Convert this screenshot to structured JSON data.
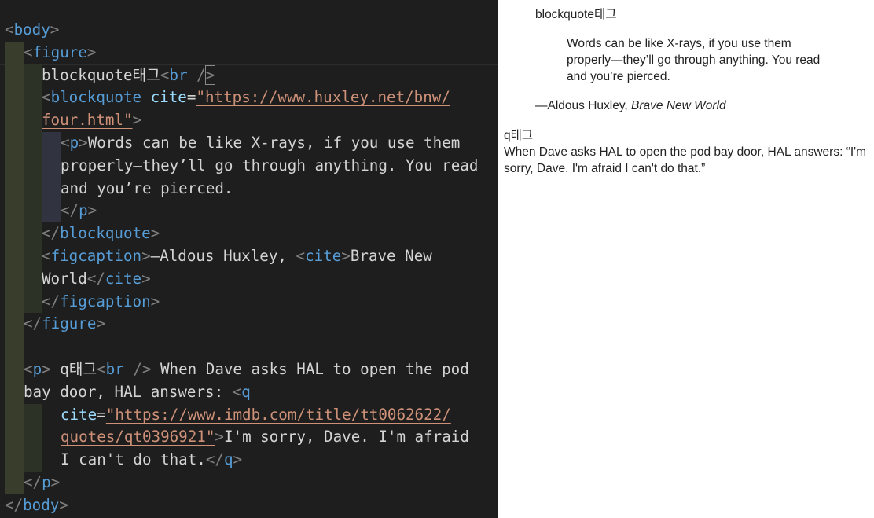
{
  "editor": {
    "lines": [
      [
        {
          "c": "tb",
          "t": "<"
        },
        {
          "c": "tg",
          "t": "body"
        },
        {
          "c": "tb",
          "t": ">"
        }
      ],
      [
        {
          "c": "tb",
          "t": "<"
        },
        {
          "c": "tg",
          "t": "figure"
        },
        {
          "c": "tb",
          "t": ">"
        }
      ],
      [
        {
          "c": "tx",
          "t": "blockquote태그"
        },
        {
          "c": "tb",
          "t": "<"
        },
        {
          "c": "tg",
          "t": "br"
        },
        {
          "c": "tx",
          "t": " "
        },
        {
          "c": "tb",
          "t": "/"
        },
        {
          "c": "tb cursor-box",
          "t": ">"
        }
      ],
      [
        {
          "c": "tb",
          "t": "<"
        },
        {
          "c": "tg",
          "t": "blockquote"
        },
        {
          "c": "tx",
          "t": " "
        },
        {
          "c": "at",
          "t": "cite"
        },
        {
          "c": "tx",
          "t": "="
        },
        {
          "c": "av",
          "t": "\"https://www.huxley.net/bnw/"
        }
      ],
      [
        {
          "c": "av",
          "t": "four.html"
        },
        {
          "c": "av",
          "t": "\""
        },
        {
          "c": "tb",
          "t": ">"
        }
      ],
      [
        {
          "c": "tb",
          "t": "<"
        },
        {
          "c": "tg",
          "t": "p"
        },
        {
          "c": "tb",
          "t": ">"
        },
        {
          "c": "tx",
          "t": "Words can be like X-rays, if you use them"
        }
      ],
      [
        {
          "c": "tx",
          "t": "properly—they’ll go through anything. You read"
        }
      ],
      [
        {
          "c": "tx",
          "t": "and you’re pierced."
        }
      ],
      [
        {
          "c": "tb",
          "t": "</"
        },
        {
          "c": "tg",
          "t": "p"
        },
        {
          "c": "tb",
          "t": ">"
        }
      ],
      [
        {
          "c": "tb",
          "t": "</"
        },
        {
          "c": "tg",
          "t": "blockquote"
        },
        {
          "c": "tb",
          "t": ">"
        }
      ],
      [
        {
          "c": "tb",
          "t": "<"
        },
        {
          "c": "tg",
          "t": "figcaption"
        },
        {
          "c": "tb",
          "t": ">"
        },
        {
          "c": "tx",
          "t": "—Aldous Huxley, "
        },
        {
          "c": "tb",
          "t": "<"
        },
        {
          "c": "tg",
          "t": "cite"
        },
        {
          "c": "tb",
          "t": ">"
        },
        {
          "c": "tx",
          "t": "Brave New"
        }
      ],
      [
        {
          "c": "tx",
          "t": "World"
        },
        {
          "c": "tb",
          "t": "</"
        },
        {
          "c": "tg",
          "t": "cite"
        },
        {
          "c": "tb",
          "t": ">"
        }
      ],
      [
        {
          "c": "tb",
          "t": "</"
        },
        {
          "c": "tg",
          "t": "figcaption"
        },
        {
          "c": "tb",
          "t": ">"
        }
      ],
      [
        {
          "c": "tb",
          "t": "</"
        },
        {
          "c": "tg",
          "t": "figure"
        },
        {
          "c": "tb",
          "t": ">"
        }
      ],
      [],
      [
        {
          "c": "tb",
          "t": "<"
        },
        {
          "c": "tg",
          "t": "p"
        },
        {
          "c": "tb",
          "t": ">"
        },
        {
          "c": "tx",
          "t": " q태그"
        },
        {
          "c": "tb",
          "t": "<"
        },
        {
          "c": "tg",
          "t": "br"
        },
        {
          "c": "tx",
          "t": " "
        },
        {
          "c": "tb",
          "t": "/>"
        },
        {
          "c": "tx",
          "t": " When Dave asks HAL to open the pod"
        }
      ],
      [
        {
          "c": "tx",
          "t": "bay door, HAL answers: "
        },
        {
          "c": "tb",
          "t": "<"
        },
        {
          "c": "tg",
          "t": "q"
        }
      ],
      [
        {
          "c": "at",
          "t": "cite"
        },
        {
          "c": "tx",
          "t": "="
        },
        {
          "c": "av",
          "t": "\"https://www.imdb.com/title/tt0062622/"
        }
      ],
      [
        {
          "c": "av",
          "t": "quotes/qt0396921"
        },
        {
          "c": "av",
          "t": "\""
        },
        {
          "c": "tb",
          "t": ">"
        },
        {
          "c": "tx",
          "t": "I'm sorry, Dave. I'm afraid"
        }
      ],
      [
        {
          "c": "tx",
          "t": "I can't do that."
        },
        {
          "c": "tb",
          "t": "</"
        },
        {
          "c": "tg",
          "t": "q"
        },
        {
          "c": "tb",
          "t": ">"
        }
      ],
      [
        {
          "c": "tb",
          "t": "</"
        },
        {
          "c": "tg",
          "t": "p"
        },
        {
          "c": "tb",
          "t": ">"
        }
      ],
      [
        {
          "c": "tb",
          "t": "</"
        },
        {
          "c": "tg",
          "t": "body"
        },
        {
          "c": "tb",
          "t": ">"
        }
      ]
    ]
  },
  "preview": {
    "blockquote_label": "blockquote태그",
    "quote_text": "Words can be like X-rays, if you use them properly—they’ll go through anything. You read and you’re pierced.",
    "caption_prefix": "—Aldous Huxley, ",
    "caption_cite": "Brave New World",
    "q_label": "q태그",
    "q_intro": "When Dave asks HAL to open the pod bay door, HAL answers: ",
    "q_quote": "“I'm sorry, Dave. I'm afraid I can't do that.”"
  },
  "colors": {
    "editor_bg": "#1e1e1e",
    "tag": "#569cd6",
    "bracket": "#808080",
    "attribute": "#9cdcfe",
    "string": "#ce9178",
    "text": "#d4d4d4"
  }
}
